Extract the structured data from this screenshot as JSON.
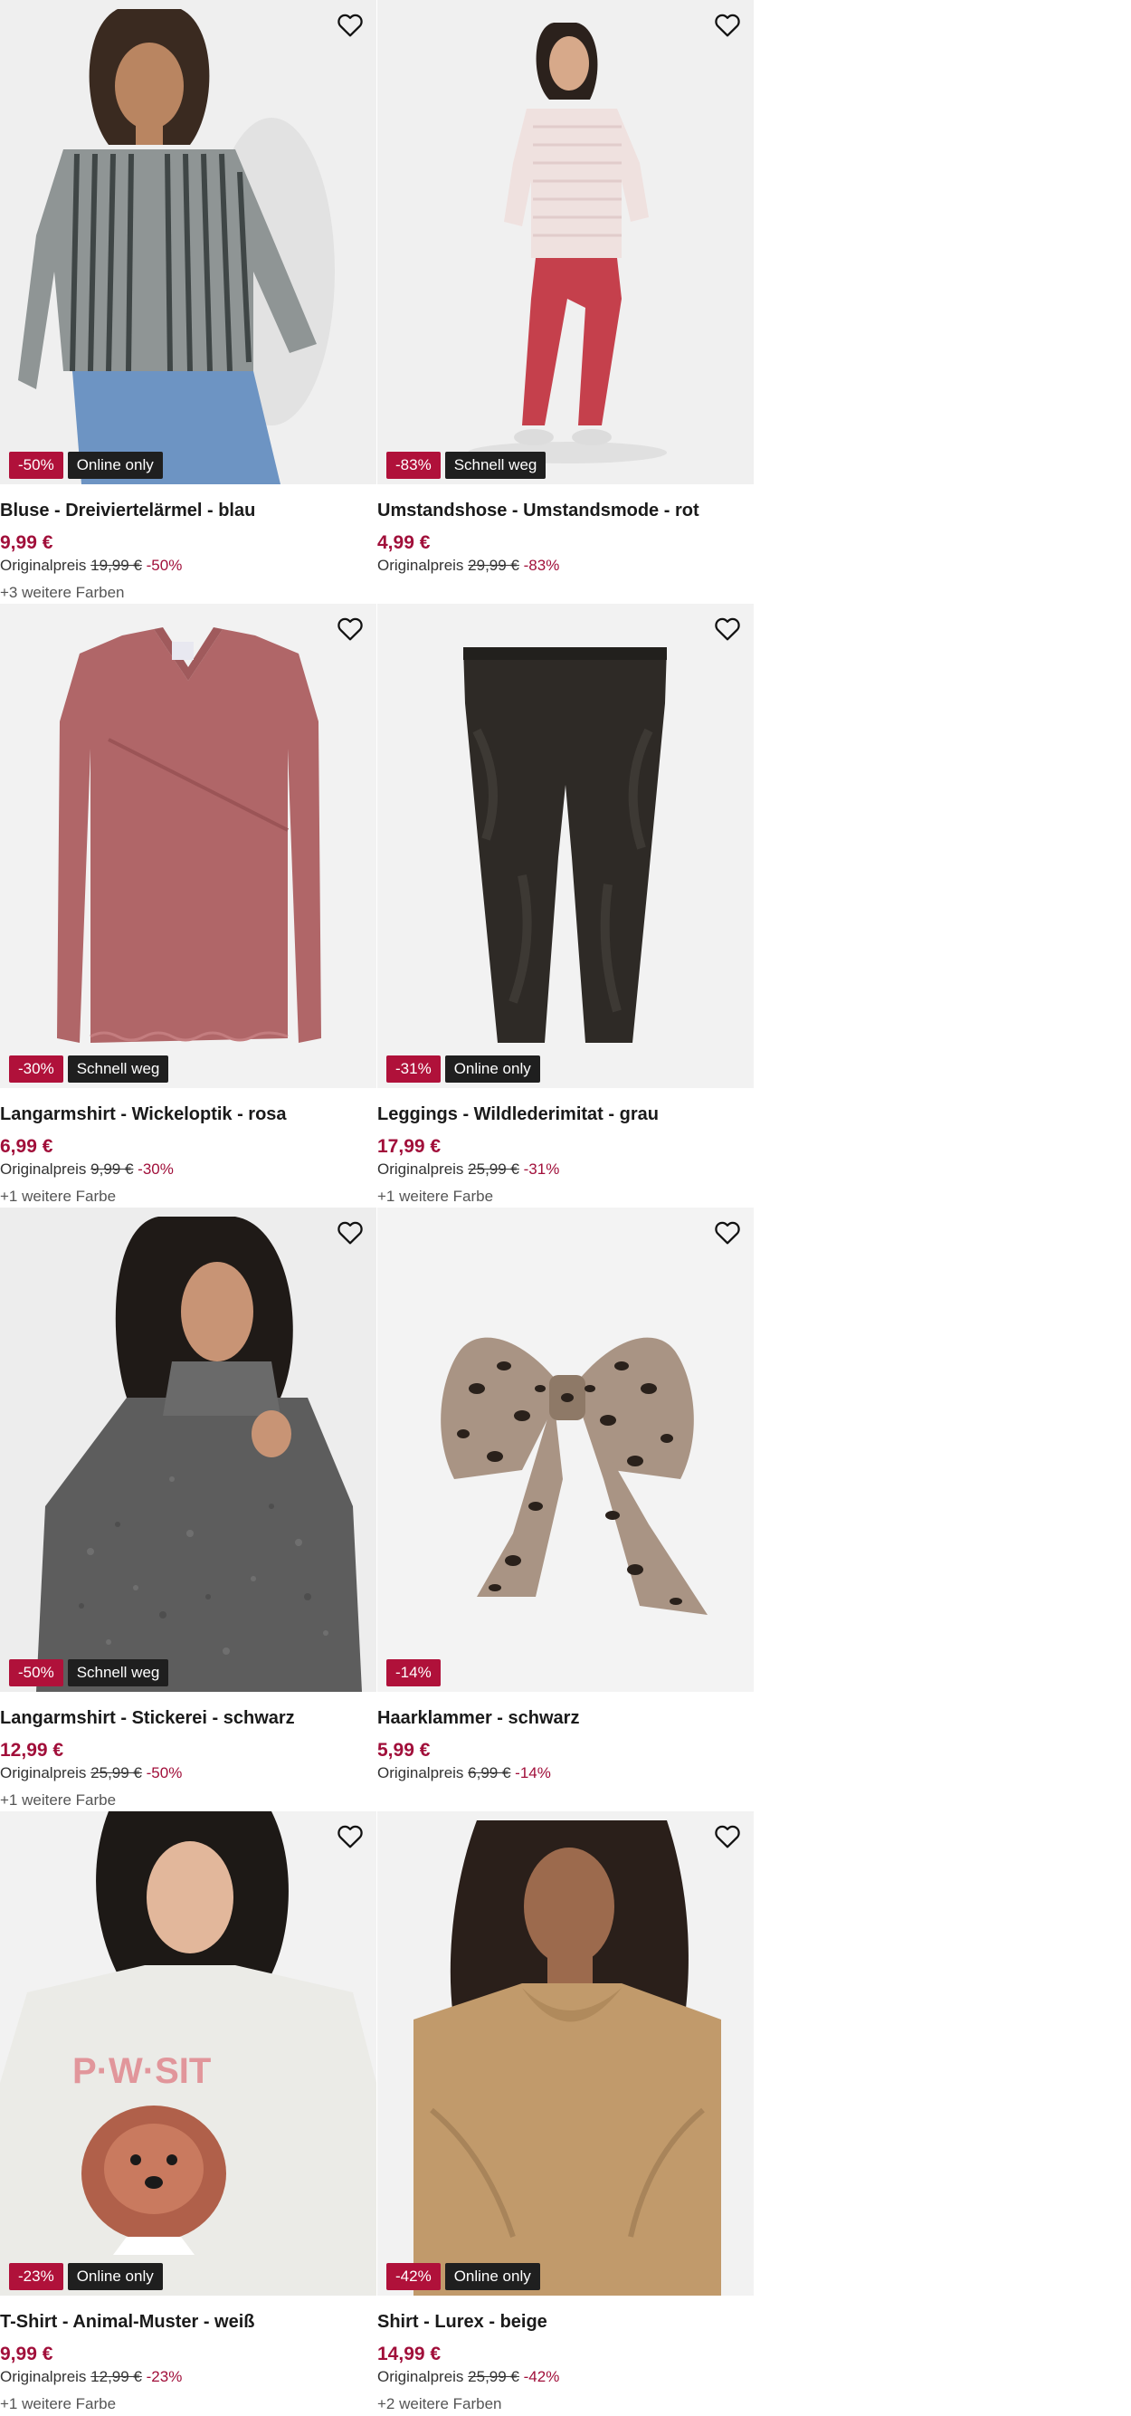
{
  "products": [
    {
      "title": "Bluse - Dreiviertelärmel - blau",
      "price": "9,99 €",
      "original_label": "Originalpreis",
      "original_price": "19,99 €",
      "discount": "-50%",
      "badge_discount": "-50%",
      "badge_tag": "Online only",
      "more_colors": "+3 weitere Farben",
      "image": "woman-striped-blouse"
    },
    {
      "title": "Umstandshose - Umstandsmode - rot",
      "price": "4,99 €",
      "original_label": "Originalpreis",
      "original_price": "29,99 €",
      "discount": "-83%",
      "badge_discount": "-83%",
      "badge_tag": "Schnell weg",
      "more_colors": "",
      "image": "pregnant-woman-red-trousers"
    },
    {
      "title": "Langarmshirt - Wickeloptik - rosa",
      "price": "6,99 €",
      "original_label": "Originalpreis",
      "original_price": "9,99 €",
      "discount": "-30%",
      "badge_discount": "-30%",
      "badge_tag": "Schnell weg",
      "more_colors": "+1 weitere Farbe",
      "image": "pink-wrap-longsleeve"
    },
    {
      "title": "Leggings - Wildlederimitat - grau",
      "price": "17,99 €",
      "original_label": "Originalpreis",
      "original_price": "25,99 €",
      "discount": "-31%",
      "badge_discount": "-31%",
      "badge_tag": "Online only",
      "more_colors": "+1 weitere Farbe",
      "image": "dark-suede-leggings"
    },
    {
      "title": "Langarmshirt - Stickerei - schwarz",
      "price": "12,99 €",
      "original_label": "Originalpreis",
      "original_price": "25,99 €",
      "discount": "-50%",
      "badge_discount": "-50%",
      "badge_tag": "Schnell weg",
      "more_colors": "+1 weitere Farbe",
      "image": "woman-grey-turtleneck"
    },
    {
      "title": "Haarklammer - schwarz",
      "price": "5,99 €",
      "original_label": "Originalpreis",
      "original_price": "6,99 €",
      "discount": "-14%",
      "badge_discount": "-14%",
      "badge_tag": "",
      "more_colors": "",
      "image": "leopard-hair-bow"
    },
    {
      "title": "T-Shirt - Animal-Muster - weiß",
      "price": "9,99 €",
      "original_label": "Originalpreis",
      "original_price": "12,99 €",
      "discount": "-23%",
      "badge_discount": "-23%",
      "badge_tag": "Online only",
      "more_colors": "+1 weitere Farbe",
      "image": "woman-poodle-tshirt"
    },
    {
      "title": "Shirt - Lurex - beige",
      "price": "14,99 €",
      "original_label": "Originalpreis",
      "original_price": "25,99 €",
      "discount": "-42%",
      "badge_discount": "-42%",
      "badge_tag": "Online only",
      "more_colors": "+2 weitere Farben",
      "image": "woman-beige-shirt"
    }
  ],
  "colors": {
    "price": "#a10f3a",
    "badge_discount": "#b0113a",
    "badge_tag": "#1f1f1f",
    "image_bg": "#f2f2f2"
  },
  "icons": {
    "wishlist": "heart-outline-icon"
  }
}
